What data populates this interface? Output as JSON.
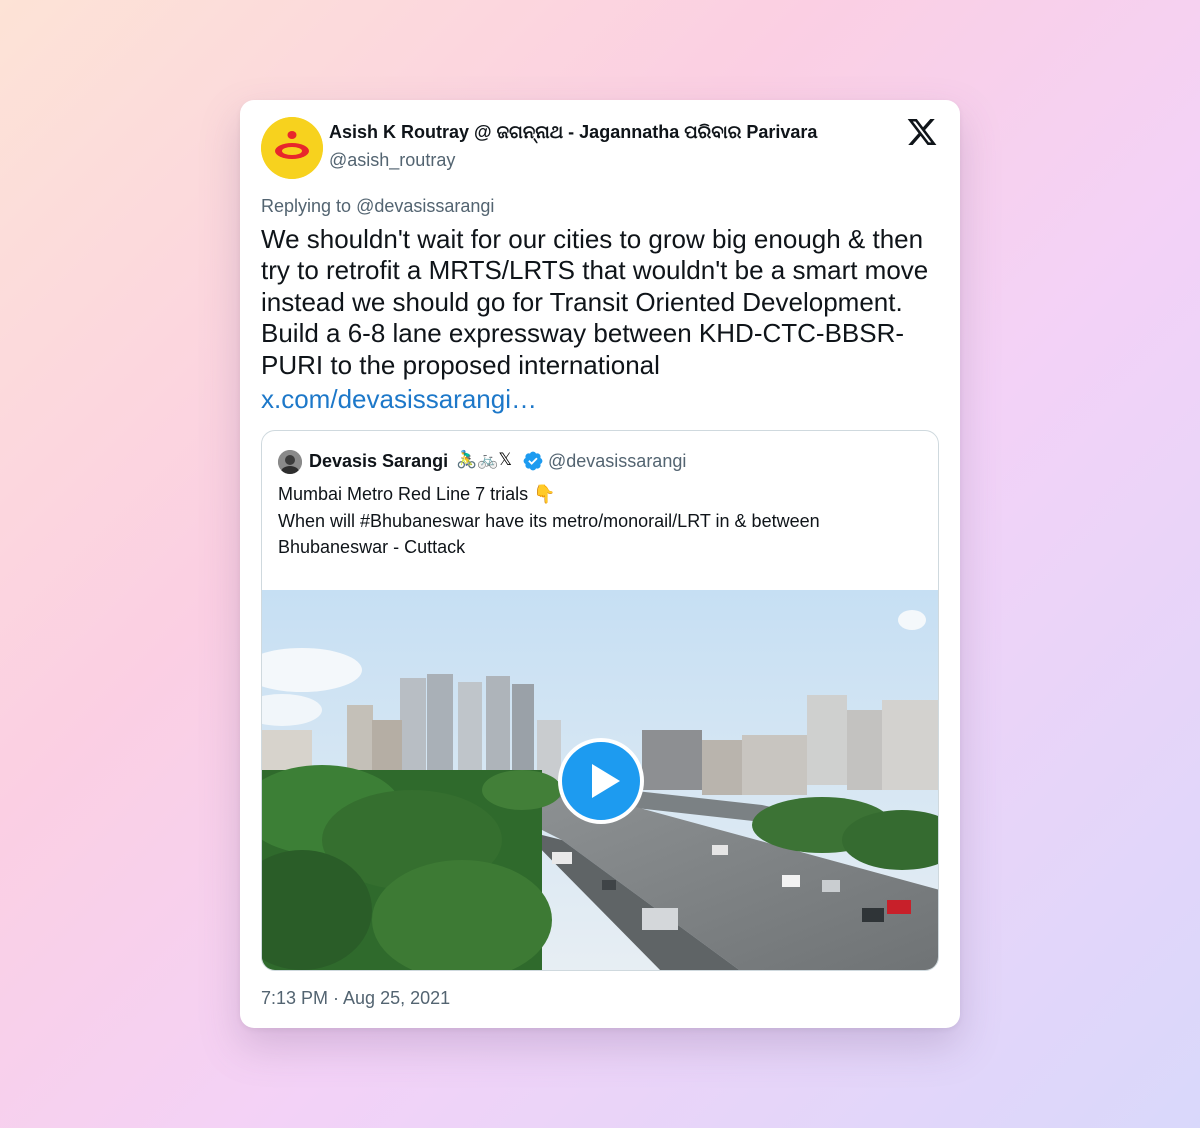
{
  "colors": {
    "accent": "#1d9bf0",
    "link": "#1d78c9",
    "muted": "#536471",
    "text": "#0f1419"
  },
  "tweet": {
    "author_name": "Asish K Routray @ ଜଗନ୍ନାଥ - Jagannatha ପରିବାର Parivara",
    "author_handle": "@asish_routray",
    "replying_prefix": "Replying to ",
    "replying_to": "@devasissarangi",
    "text": "We shouldn't wait for our cities to grow big enough & then try to retrofit a MRTS/LRTS that wouldn't be a smart move instead we should go for Transit Oriented Development. Build a 6-8 lane expressway between KHD-CTC-BBSR-PURI to the proposed international",
    "link": "x.com/devasissarangi…",
    "timestamp": "7:13 PM · Aug 25, 2021",
    "platform_icon": "x-logo-icon"
  },
  "quote": {
    "author_name": "Devasis Sarangi",
    "author_emoji": "🚴‍♂️🚲𝕏",
    "verified_icon": "verified-badge-icon",
    "author_handle": "@devasissarangi",
    "text": "Mumbai Metro Red Line 7 trials 👇\nWhen will #Bhubaneswar have its metro/monorail/LRT in & between Bhubaneswar - Cuttack",
    "media_icon": "play-icon"
  }
}
